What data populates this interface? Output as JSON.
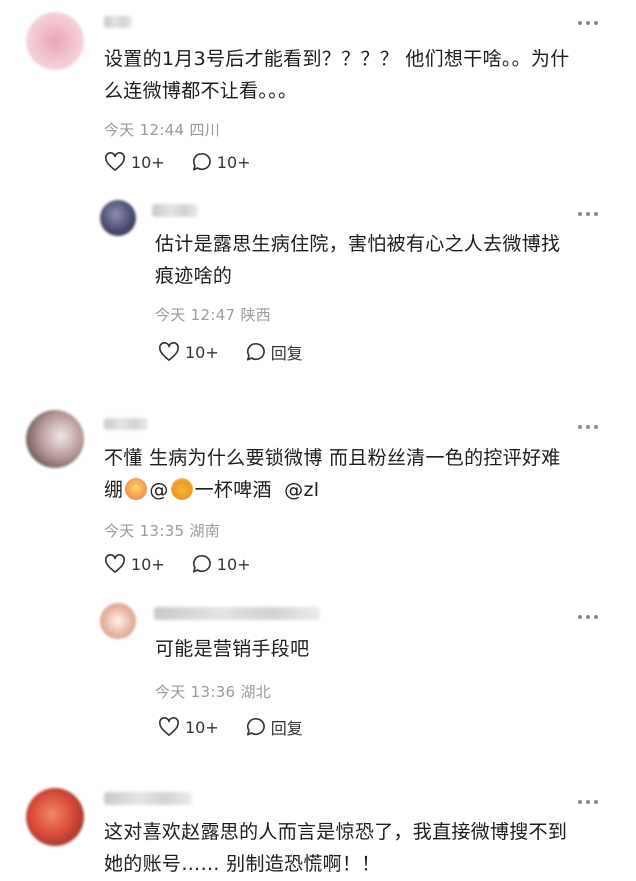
{
  "comments": [
    {
      "text": "设置的1月3号后才能看到？？？？ 他们想干啥。。为什么连微博都不让看。。。",
      "text_line1": "设置的1月3号后才能看到？？？？ 他们想干啥。。为什",
      "text_line2": "么连微博都不让看。。。",
      "meta": "今天 12:44 四川",
      "like_count": "10+",
      "reply_count": "10+",
      "avatar_color": "#f3c4cf"
    },
    {
      "text_line1": "估计是露思生病住院，害怕被有心之人去微博找",
      "text_line2": "痕迹啥的",
      "meta": "今天 12:47 陕西",
      "like_count": "10+",
      "reply_label": "回复",
      "avatar_color": "#4b4b72"
    },
    {
      "text_line1": "不懂 生病为什么要锁微博 而且粉丝清一色的控评好难",
      "text_line2_prefix": "绷",
      "mention_at1": "@",
      "mention_name1": "一杯啤酒",
      "mention_2": "@zl",
      "meta": "今天 13:35 湖南",
      "like_count": "10+",
      "reply_count": "10+",
      "avatar_color": "#b89a9a"
    },
    {
      "text_line1": "可能是营销手段吧",
      "meta": "今天 13:36 湖北",
      "like_count": "10+",
      "reply_label": "回复",
      "avatar_color": "#e9b9a6"
    },
    {
      "text_line1": "这对喜欢赵露思的人而言是惊恐了，我直接微博搜不到",
      "text_line2": "她的账号…… 别制造恐慌啊！！",
      "avatar_color": "#d94b3a"
    }
  ],
  "colors": {
    "meta": "#9a9a9a",
    "text": "#1c1c1c",
    "icon": "#333333"
  },
  "icons": {
    "like": "heart-icon",
    "reply": "speech-bubble-icon",
    "more": "more-dots-icon"
  }
}
